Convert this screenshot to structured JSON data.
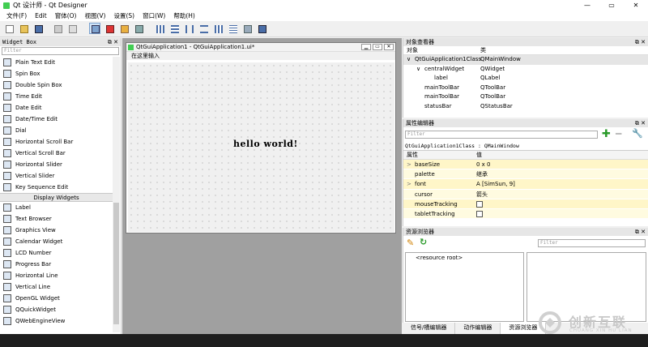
{
  "window": {
    "title": "Qt 设计师 - Qt Designer",
    "controls": [
      "—",
      "▭",
      "✕"
    ]
  },
  "menu": [
    "文件(F)",
    "Edit",
    "窗体(O)",
    "视图(V)",
    "设置(S)",
    "窗口(W)",
    "帮助(H)"
  ],
  "widget_box": {
    "title": "Widget Box",
    "filter_placeholder": "Filter",
    "items_before": [
      "Plain Text Edit",
      "Spin Box",
      "Double Spin Box",
      "Time Edit",
      "Date Edit",
      "Date/Time Edit",
      "Dial",
      "Horizontal Scroll Bar",
      "Vertical Scroll Bar",
      "Horizontal Slider",
      "Vertical Slider",
      "Key Sequence Edit"
    ],
    "category": "Display Widgets",
    "items_after": [
      "Label",
      "Text Browser",
      "Graphics View",
      "Calendar Widget",
      "LCD Number",
      "Progress Bar",
      "Horizontal Line",
      "Vertical Line",
      "OpenGL Widget",
      "QQuickWidget",
      "QWebEngineView"
    ]
  },
  "form": {
    "title": "QtGuiApplication1 - QtGuiApplication1.ui*",
    "menu_hint": "在这里输入",
    "label_text": "hello world!"
  },
  "object_inspector": {
    "title": "对象查看器",
    "headers": [
      "对象",
      "类"
    ],
    "rows": [
      {
        "name": "QtGuiApplication1Class",
        "cls": "QMainWindow",
        "indent": 0,
        "arrow": "∨"
      },
      {
        "name": "centralWidget",
        "cls": "QWidget",
        "indent": 1,
        "arrow": "∨"
      },
      {
        "name": "label",
        "cls": "QLabel",
        "indent": 2,
        "arrow": ""
      },
      {
        "name": "mainToolBar",
        "cls": "QToolBar",
        "indent": 1,
        "arrow": ""
      },
      {
        "name": "mainToolBar",
        "cls": "QToolBar",
        "indent": 1,
        "arrow": ""
      },
      {
        "name": "statusBar",
        "cls": "QStatusBar",
        "indent": 1,
        "arrow": ""
      }
    ]
  },
  "property_editor": {
    "title": "属性编辑器",
    "filter_placeholder": "Filter",
    "context": "QtGuiApplication1Class : QMainWindow",
    "headers": [
      "属性",
      "值"
    ],
    "rows": [
      {
        "name": "baseSize",
        "value": "0 x 0",
        "arrow": ">"
      },
      {
        "name": "palette",
        "value": "继承",
        "arrow": ""
      },
      {
        "name": "font",
        "value": "A  [SimSun, 9]",
        "arrow": ">"
      },
      {
        "name": "cursor",
        "value": "箭头",
        "arrow": ""
      },
      {
        "name": "mouseTracking",
        "value": "",
        "arrow": ""
      },
      {
        "name": "tabletTracking",
        "value": "",
        "arrow": ""
      }
    ]
  },
  "resource_browser": {
    "title": "资源浏览器",
    "filter_placeholder": "Filter",
    "root": "<resource root>"
  },
  "bottom_tabs": [
    "信号/槽编辑器",
    "动作编辑器",
    "资源浏览器"
  ],
  "watermark": {
    "main": "创新互联",
    "sub": "CHUANG XIN HU LIAN"
  },
  "colors": {
    "accent": "#cfe3f7",
    "prop_row": "#fff6c8",
    "qt_green": "#41cd52"
  }
}
